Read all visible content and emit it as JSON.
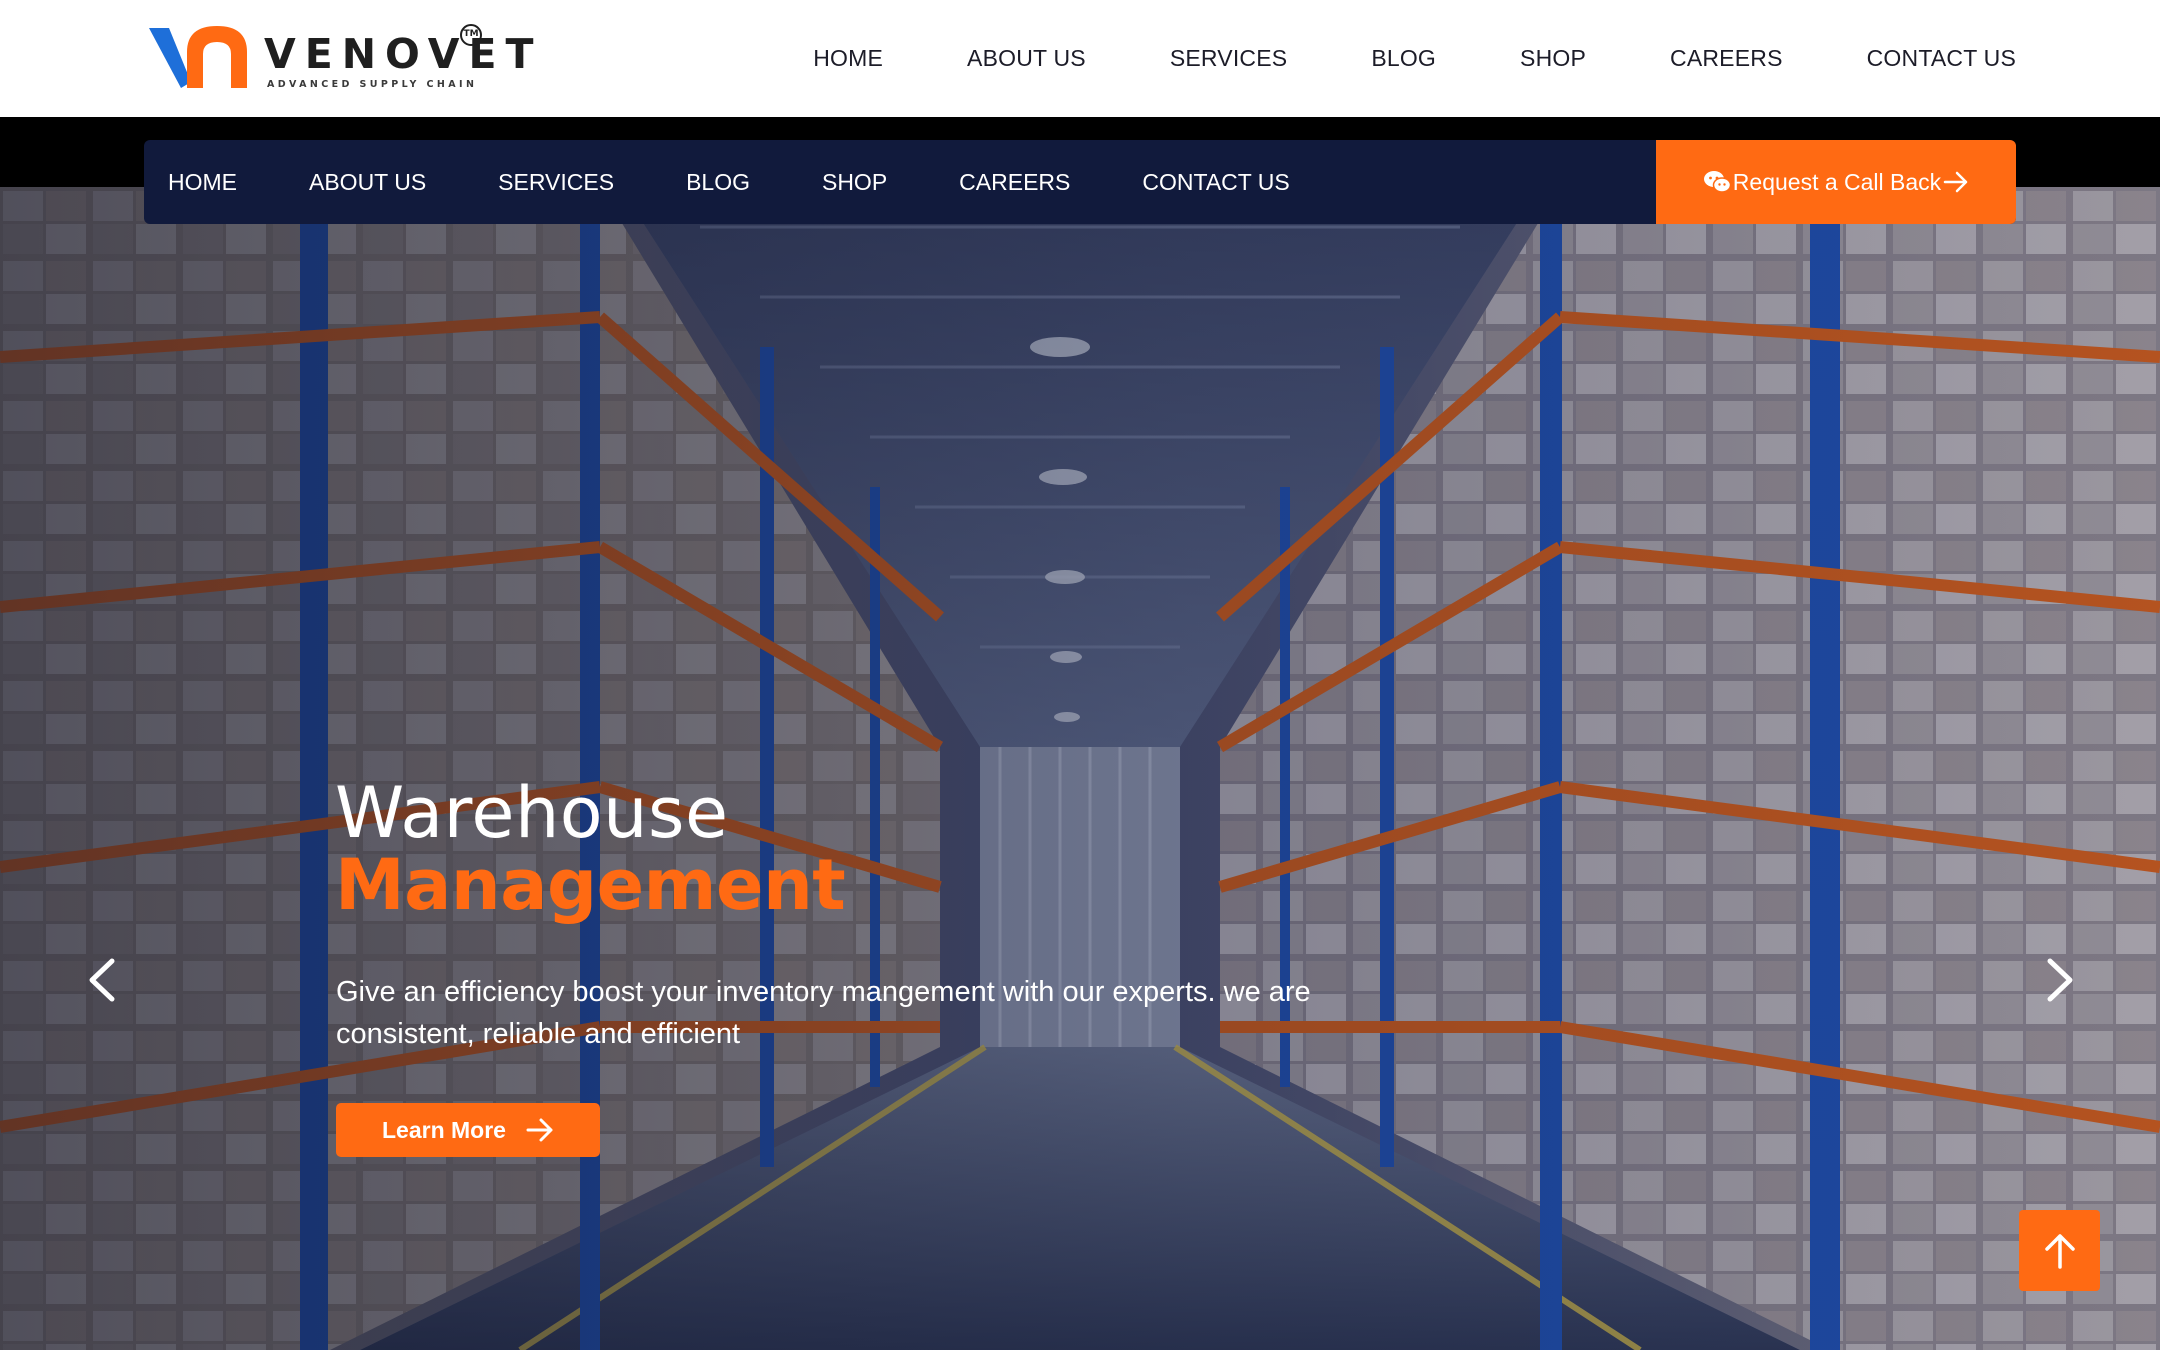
{
  "brand": {
    "name": "VENOVET",
    "tagline": "ADVANCED SUPPLY CHAIN",
    "trademark": "TM",
    "colors": {
      "accent": "#ff6a13",
      "blue": "#1e6fd9",
      "navy": "#111a3c"
    }
  },
  "top_nav": {
    "items": [
      {
        "label": "HOME"
      },
      {
        "label": "ABOUT US"
      },
      {
        "label": "SERVICES"
      },
      {
        "label": "BLOG"
      },
      {
        "label": "SHOP"
      },
      {
        "label": "CAREERS"
      },
      {
        "label": "CONTACT US"
      }
    ]
  },
  "nav_bar": {
    "items": [
      {
        "label": "HOME"
      },
      {
        "label": "ABOUT US"
      },
      {
        "label": "SERVICES"
      },
      {
        "label": "BLOG"
      },
      {
        "label": "SHOP"
      },
      {
        "label": "CAREERS"
      },
      {
        "label": "CONTACT US"
      }
    ],
    "cta": {
      "label": "Request a Call Back",
      "icon": "wechat-icon",
      "arrow_icon": "arrow-right-icon"
    }
  },
  "hero": {
    "title_line1": "Warehouse",
    "title_line2": "Management",
    "description": "Give an efficiency boost your inventory mangement with our experts. we are consistent, reliable and efficient",
    "button": {
      "label": "Learn More",
      "icon": "arrow-right-icon"
    },
    "prev_icon": "chevron-left-icon",
    "next_icon": "chevron-right-icon"
  },
  "scroll_top": {
    "icon": "arrow-up-icon"
  }
}
